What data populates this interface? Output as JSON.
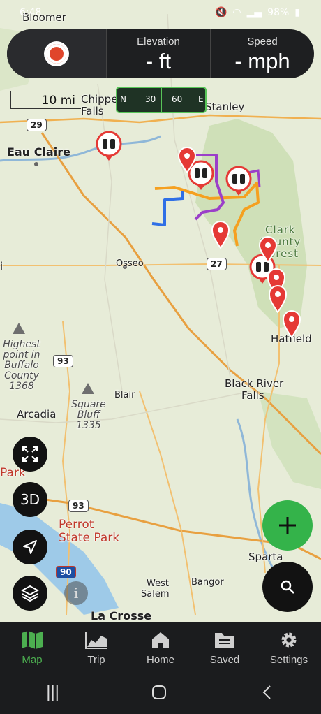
{
  "status": {
    "time": "6:48",
    "battery": "98%"
  },
  "hud": {
    "elevation_title": "Elevation",
    "elevation_value": "- ft",
    "speed_title": "Speed",
    "speed_value": "- mph"
  },
  "scale_label": "10 mi",
  "compass": {
    "n": "N",
    "a": "30",
    "b": "60",
    "e": "E"
  },
  "map_labels": {
    "bloomer": "Bloomer",
    "chippewa": "Chippewa",
    "falls": "Falls",
    "stanley": "Stanley",
    "eau_claire": "Eau Claire",
    "osseo": "Osseo",
    "clark": "Clark",
    "county": "County",
    "forest": "Forest",
    "hatfield": "Hatfield",
    "highest": "Highest",
    "point_in": "point in",
    "buffalo": "Buffalo",
    "county2": "County",
    "h1368": "1368",
    "black_river": "Black River",
    "falls2": "Falls",
    "blair": "Blair",
    "square": "Square",
    "bluff": "Bluff",
    "h1335": "1335",
    "arcadia": "Arcadia",
    "perrot1": "Perrot",
    "perrot2": "State Park",
    "sparta": "Sparta",
    "west": "West",
    "salem": "Salem",
    "bangor": "Bangor",
    "la_crosse": "La Crosse",
    "park_edge": "Park",
    "i_edge": "i"
  },
  "route_shields": {
    "r29": "29",
    "r27": "27",
    "r93a": "93",
    "r93b": "93",
    "i90": "90"
  },
  "buttons": {
    "three_d": "3D"
  },
  "tabs": [
    {
      "label": "Map",
      "icon": "map-icon"
    },
    {
      "label": "Trip",
      "icon": "trip-chart-icon"
    },
    {
      "label": "Home",
      "icon": "home-icon"
    },
    {
      "label": "Saved",
      "icon": "folder-icon"
    },
    {
      "label": "Settings",
      "icon": "gear-icon"
    }
  ],
  "colors": {
    "accent": "#34b34a",
    "record": "#e0452b",
    "pin": "#e53935"
  }
}
